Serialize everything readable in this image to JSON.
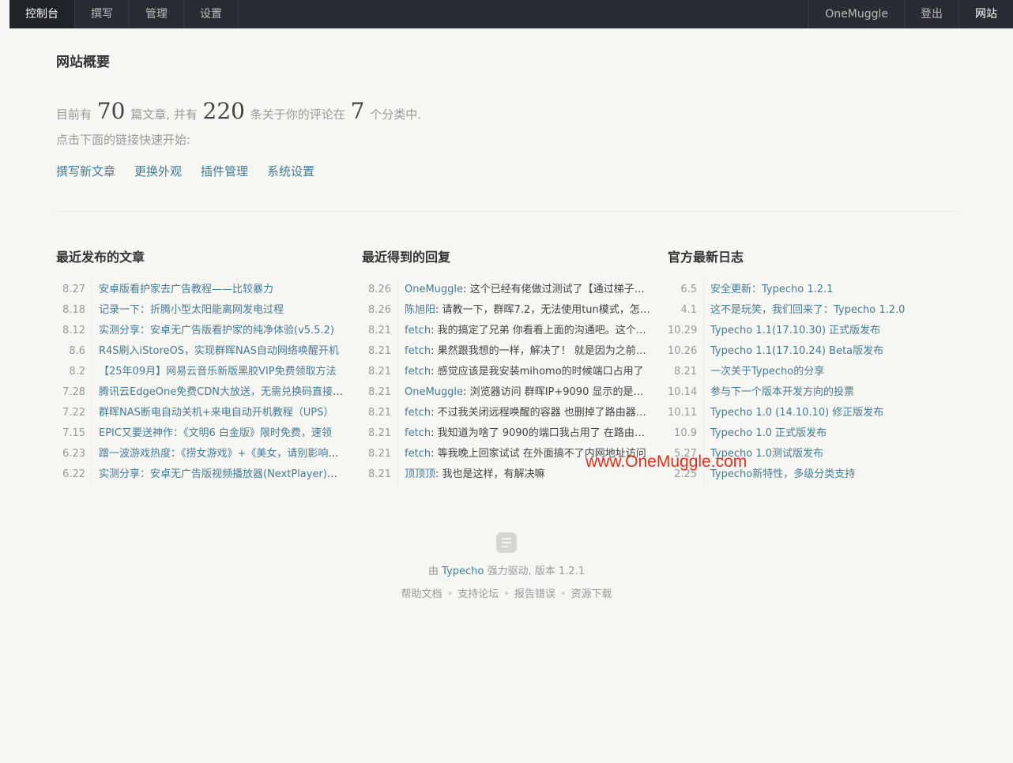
{
  "nav": {
    "left": [
      "控制台",
      "撰写",
      "管理",
      "设置"
    ],
    "right": [
      "OneMuggle",
      "登出",
      "网站"
    ]
  },
  "page_title": "网站概要",
  "summary": {
    "prefix": "目前有",
    "posts": "70",
    "posts_text": "篇文章, 并有",
    "comments": "220",
    "comments_text": "条关于你的评论在",
    "categories": "7",
    "categories_text": "个分类中.",
    "hint": "点击下面的链接快速开始:"
  },
  "quick_links": [
    "撰写新文章",
    "更换外观",
    "插件管理",
    "系统设置"
  ],
  "recent_posts": {
    "title": "最近发布的文章",
    "items": [
      {
        "date": "8.27",
        "title": "安卓版看护家去广告教程——比较暴力"
      },
      {
        "date": "8.18",
        "title": "记录一下：折腾小型太阳能离网发电过程"
      },
      {
        "date": "8.12",
        "title": "实测分享：安卓无广告版看护家的纯净体验(v5.5.2)"
      },
      {
        "date": "8.6",
        "title": "R4S刷入iStoreOS，实现群晖NAS自动网络唤醒开机"
      },
      {
        "date": "8.2",
        "title": "【25年09月】网易云音乐新版黑胶VIP免费领取方法"
      },
      {
        "date": "7.28",
        "title": "腾讯云EdgeOne免费CDN大放送，无需兑换码直接领取"
      },
      {
        "date": "7.22",
        "title": "群晖NAS断电自动关机+来电自动开机教程（UPS）"
      },
      {
        "date": "7.15",
        "title": "EPIC又要送神作：《文明6 白金版》限时免费，速领"
      },
      {
        "date": "6.23",
        "title": "蹭一波游戏热度：《捞女游戏》+《美女，请别影响我学习》"
      },
      {
        "date": "6.22",
        "title": "实测分享：安卓无广告版视频播放器(NextPlayer)推荐"
      }
    ]
  },
  "recent_replies": {
    "title": "最近得到的回复",
    "items": [
      {
        "date": "8.26",
        "author": "OneMuggle",
        "text": "这个已经有佬做过测试了【通过梯子访问】"
      },
      {
        "date": "8.26",
        "author": "陈旭阳",
        "text": "请教一下，群晖7.2，无法使用tun模式，怎么办"
      },
      {
        "date": "8.21",
        "author": "fetch",
        "text": "我的搞定了兄弟 你看看上面的沟通吧。这个问题"
      },
      {
        "date": "8.21",
        "author": "fetch",
        "text": "果然跟我想的一样，解决了！ 就是因为之前的设置"
      },
      {
        "date": "8.21",
        "author": "fetch",
        "text": "感觉应该是我安装mihomo的时候端口占用了"
      },
      {
        "date": "8.21",
        "author": "OneMuggle",
        "text": "浏览器访问 群晖IP+9090 显示的是什么内容"
      },
      {
        "date": "8.21",
        "author": "fetch",
        "text": "不过我关闭远程唤醒的容器 也删掉了路由器上的"
      },
      {
        "date": "8.21",
        "author": "fetch",
        "text": "我知道为啥了 9090的端口我占用了 在路由器上"
      },
      {
        "date": "8.21",
        "author": "fetch",
        "text": "等我晚上回家试试 在外面搞不了内网地址访问"
      },
      {
        "date": "8.21",
        "author": "顶顶顶",
        "text": "我也是这样，有解决嘛"
      }
    ]
  },
  "official_log": {
    "title": "官方最新日志",
    "items": [
      {
        "date": "6.5",
        "title": "安全更新：Typecho 1.2.1"
      },
      {
        "date": "4.1",
        "title": "这不是玩笑，我们回来了：Typecho 1.2.0"
      },
      {
        "date": "10.29",
        "title": "Typecho 1.1(17.10.30) 正式版发布"
      },
      {
        "date": "10.26",
        "title": "Typecho 1.1(17.10.24) Beta版发布"
      },
      {
        "date": "8.21",
        "title": "一次关于Typecho的分享"
      },
      {
        "date": "10.14",
        "title": "参与下一个版本开发方向的投票"
      },
      {
        "date": "10.11",
        "title": "Typecho 1.0 (14.10.10) 修正版发布"
      },
      {
        "date": "10.9",
        "title": "Typecho 1.0 正式版发布"
      },
      {
        "date": "5.27",
        "title": "Typecho 1.0测试版发布"
      },
      {
        "date": "2.25",
        "title": "Typecho新特性，多级分类支持"
      }
    ]
  },
  "watermark": "www.OneMuggle.com",
  "footer": {
    "powered_prefix": "由",
    "powered_link": "Typecho",
    "powered_suffix": "强力驱动, 版本 1.2.1",
    "links": [
      "帮助文档",
      "支持论坛",
      "报告错误",
      "资源下载"
    ]
  }
}
